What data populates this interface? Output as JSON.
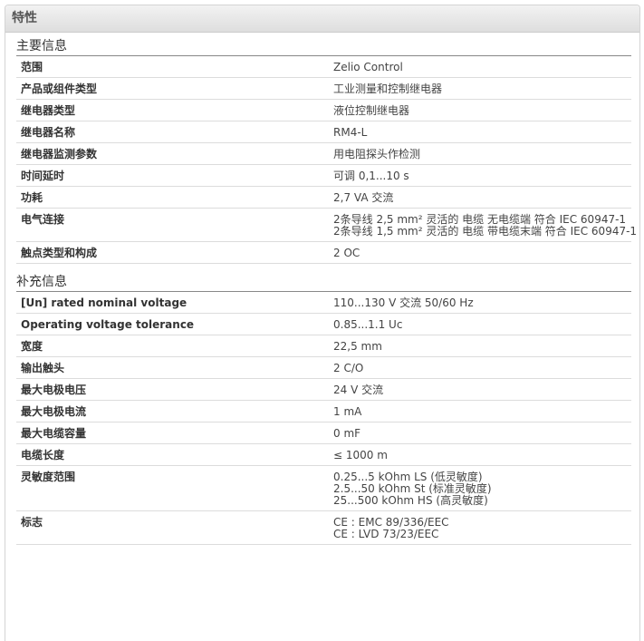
{
  "panel": {
    "title": "特性"
  },
  "main_section": {
    "title": "主要信息",
    "rows": [
      {
        "label": "范围",
        "values": [
          "Zelio Control"
        ]
      },
      {
        "label": "产品或组件类型",
        "values": [
          "工业测量和控制继电器"
        ]
      },
      {
        "label": "继电器类型",
        "values": [
          "液位控制继电器"
        ]
      },
      {
        "label": "继电器名称",
        "values": [
          "RM4-L"
        ]
      },
      {
        "label": "继电器监测参数",
        "values": [
          "用电阻探头作检测"
        ]
      },
      {
        "label": "时间延时",
        "values": [
          "可调 0,1...10 s"
        ]
      },
      {
        "label": "功耗",
        "values": [
          "2,7 VA 交流"
        ]
      },
      {
        "label": "电气连接",
        "values": [
          "2条导线 2,5 mm² 灵活的 电缆 无电缆端 符合 IEC 60947-1",
          "2条导线 1,5 mm² 灵活的 电缆 带电缆末端 符合 IEC 60947-1"
        ]
      },
      {
        "label": "触点类型和构成",
        "values": [
          "2 OC"
        ]
      }
    ]
  },
  "extra_section": {
    "title": "补充信息",
    "rows": [
      {
        "label": "[Un] rated nominal voltage",
        "values": [
          "110...130 V 交流 50/60 Hz"
        ]
      },
      {
        "label": "Operating voltage tolerance",
        "values": [
          "0.85...1.1 Uc"
        ]
      },
      {
        "label": "宽度",
        "values": [
          "22,5 mm"
        ]
      },
      {
        "label": "输出触头",
        "values": [
          "2 C/O"
        ]
      },
      {
        "label": "最大电极电压",
        "values": [
          "24 V 交流"
        ]
      },
      {
        "label": "最大电极电流",
        "values": [
          "1 mA"
        ]
      },
      {
        "label": "最大电缆容量",
        "values": [
          "0 mF"
        ]
      },
      {
        "label": "电缆长度",
        "values": [
          "≤ 1000 m"
        ]
      },
      {
        "label": "灵敏度范围",
        "values": [
          "0.25...5 kOhm LS (低灵敏度)",
          "2.5...50 kOhm St (标准灵敏度)",
          "25...500 kOhm HS (高灵敏度)"
        ]
      },
      {
        "label": "标志",
        "values": [
          "CE : EMC 89/336/EEC",
          "CE : LVD 73/23/EEC"
        ]
      }
    ]
  }
}
